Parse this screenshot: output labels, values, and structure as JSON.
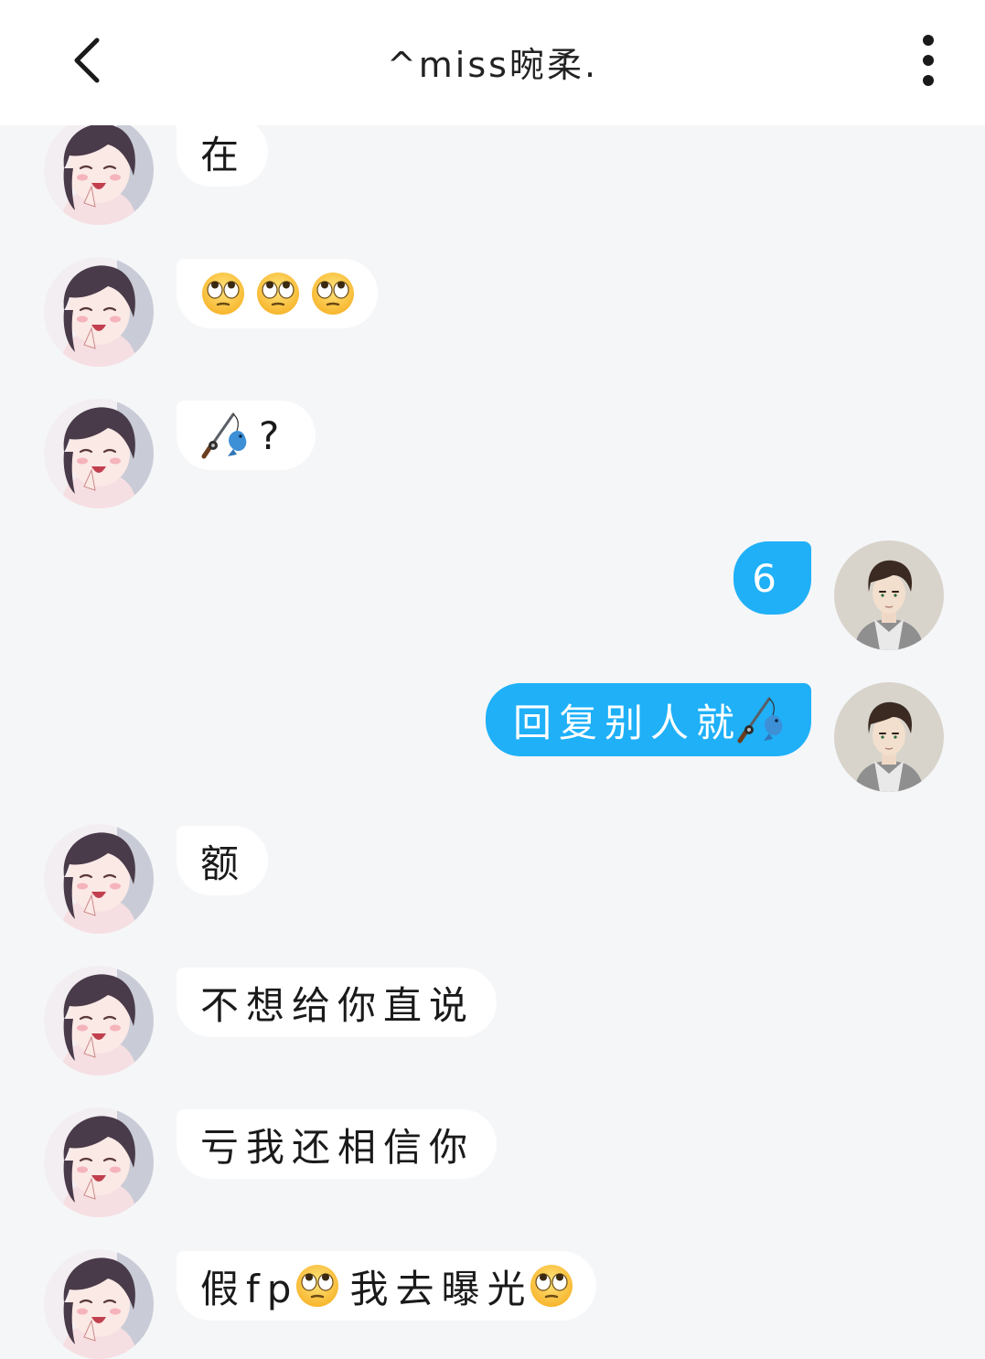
{
  "header": {
    "title": "^miss晼柔.",
    "back_icon": "chevron-left-icon",
    "more_icon": "more-vertical-icon"
  },
  "colors": {
    "outgoing_bubble": "#1fb0f8",
    "incoming_bubble": "#ffffff",
    "background": "#f5f6f8"
  },
  "messages": [
    {
      "from": "contact",
      "parts": [
        {
          "type": "text",
          "value": "在"
        }
      ]
    },
    {
      "from": "contact",
      "parts": [
        {
          "type": "emoji",
          "icon": "eye-roll-emoji"
        },
        {
          "type": "emoji",
          "icon": "eye-roll-emoji"
        },
        {
          "type": "emoji",
          "icon": "eye-roll-emoji"
        }
      ]
    },
    {
      "from": "contact",
      "parts": [
        {
          "type": "emoji",
          "icon": "fishing-pole-emoji"
        },
        {
          "type": "text",
          "value": "?"
        }
      ]
    },
    {
      "from": "me",
      "parts": [
        {
          "type": "text",
          "value": "6"
        }
      ]
    },
    {
      "from": "me",
      "parts": [
        {
          "type": "text",
          "value": "回复别人就"
        },
        {
          "type": "emoji",
          "icon": "fishing-pole-emoji"
        }
      ]
    },
    {
      "from": "contact",
      "parts": [
        {
          "type": "text",
          "value": "额"
        }
      ]
    },
    {
      "from": "contact",
      "parts": [
        {
          "type": "text",
          "value": "不想给你直说"
        }
      ]
    },
    {
      "from": "contact",
      "parts": [
        {
          "type": "text",
          "value": "亏我还相信你"
        }
      ]
    },
    {
      "from": "contact",
      "parts": [
        {
          "type": "text",
          "value": "假fp"
        },
        {
          "type": "emoji",
          "icon": "eye-roll-emoji"
        },
        {
          "type": "text",
          "value": "我去曝光"
        },
        {
          "type": "emoji",
          "icon": "eye-roll-emoji"
        }
      ]
    }
  ]
}
